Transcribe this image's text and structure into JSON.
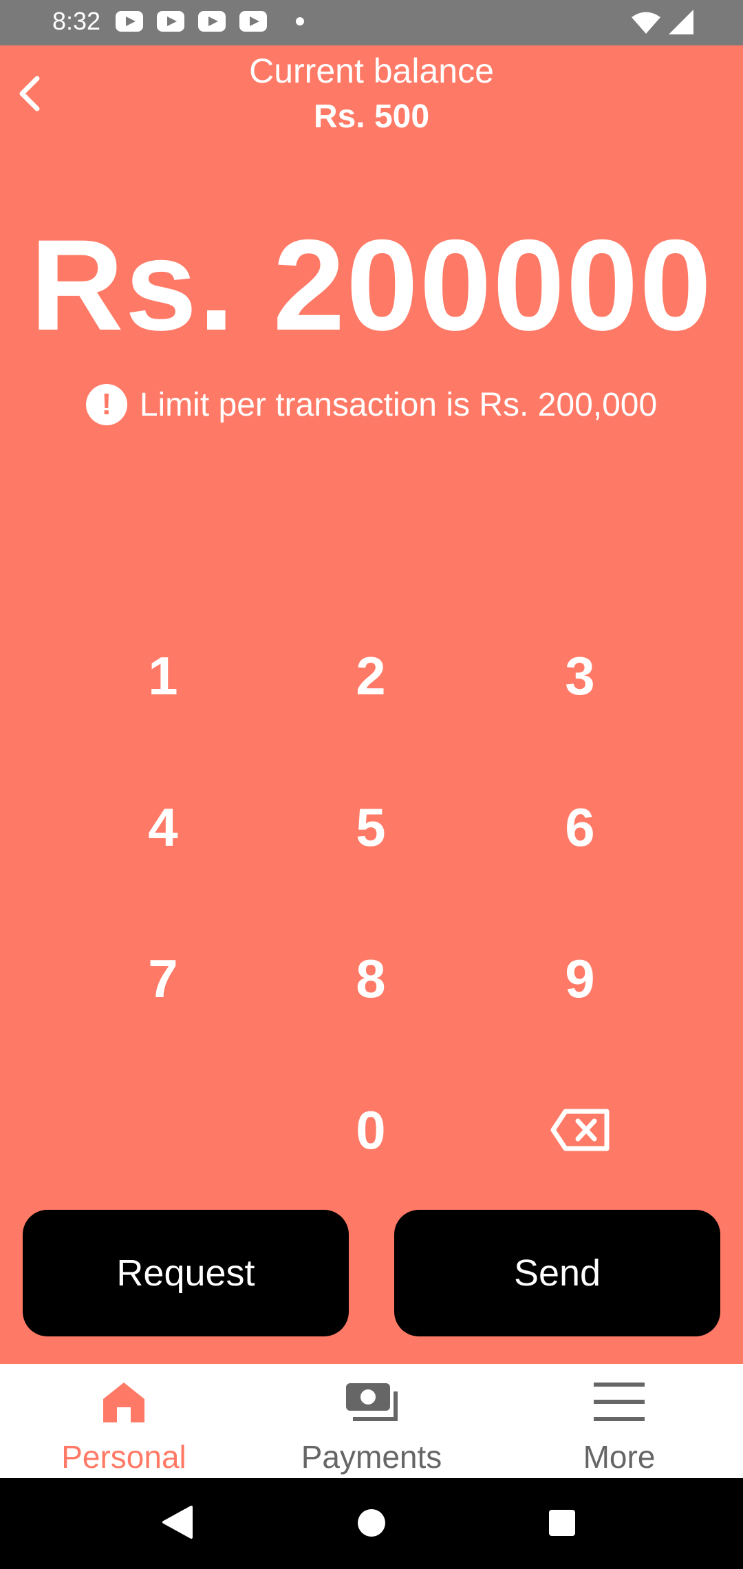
{
  "status_bar": {
    "time": "8:32"
  },
  "header": {
    "balance_label": "Current balance",
    "balance_value": "Rs. 500"
  },
  "amount": {
    "value": "Rs. 200000"
  },
  "limit": {
    "warning_symbol": "!",
    "message": "Limit per transaction is Rs. 200,000"
  },
  "keypad": {
    "keys": [
      "1",
      "2",
      "3",
      "4",
      "5",
      "6",
      "7",
      "8",
      "9",
      "0"
    ]
  },
  "actions": {
    "request_label": "Request",
    "send_label": "Send"
  },
  "bottom_nav": {
    "items": [
      {
        "label": "Personal",
        "icon": "home-icon",
        "active": true
      },
      {
        "label": "Payments",
        "icon": "cash-icon",
        "active": false
      },
      {
        "label": "More",
        "icon": "menu-icon",
        "active": false
      }
    ]
  },
  "colors": {
    "accent": "#ff7a66",
    "inactive": "#666666",
    "button": "#000000"
  }
}
